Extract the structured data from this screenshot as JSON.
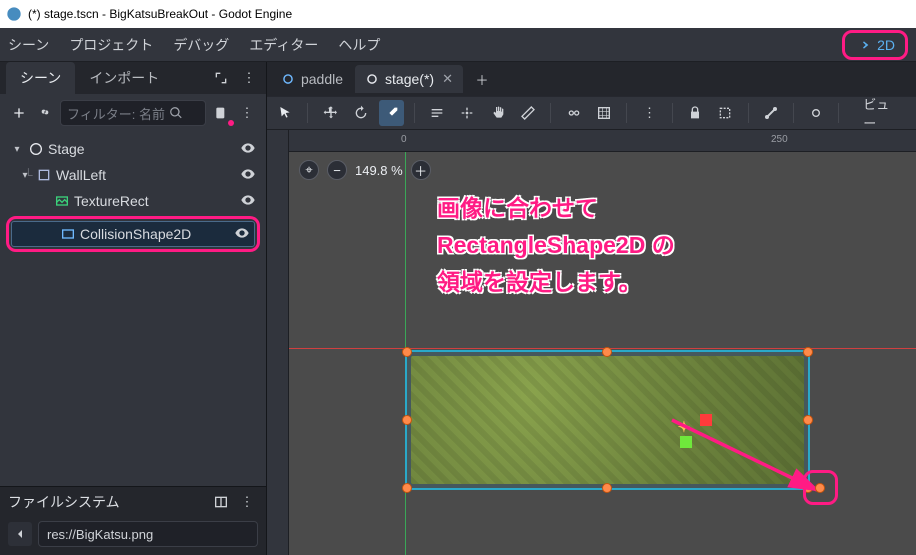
{
  "window": {
    "title": "(*) stage.tscn - BigKatsuBreakOut - Godot Engine"
  },
  "menu": {
    "scene": "シーン",
    "project": "プロジェクト",
    "debug": "デバッグ",
    "editor": "エディター",
    "help": "ヘルプ",
    "two_d": "2D"
  },
  "scene_dock": {
    "tab_scene": "シーン",
    "tab_import": "インポート",
    "filter_placeholder": "フィルター: 名前",
    "nodes": {
      "stage": "Stage",
      "wall_left": "WallLeft",
      "texture_rect": "TextureRect",
      "collision": "CollisionShape2D"
    }
  },
  "fs_dock": {
    "title": "ファイルシステム",
    "path": "res://BigKatsu.png"
  },
  "editor_tabs": {
    "paddle": "paddle",
    "stage": "stage(*)"
  },
  "viewport": {
    "zoom": "149.8 %",
    "ruler_0": "0",
    "ruler_250": "250",
    "view_label": "ビュー"
  },
  "annotation": {
    "line1": "画像に合わせて",
    "line2": "RectangleShape2D の",
    "line3": "領域を設定します。"
  },
  "icons": {
    "search": "search",
    "plus": "plus",
    "link": "link",
    "more": "more"
  },
  "chart_data": null
}
